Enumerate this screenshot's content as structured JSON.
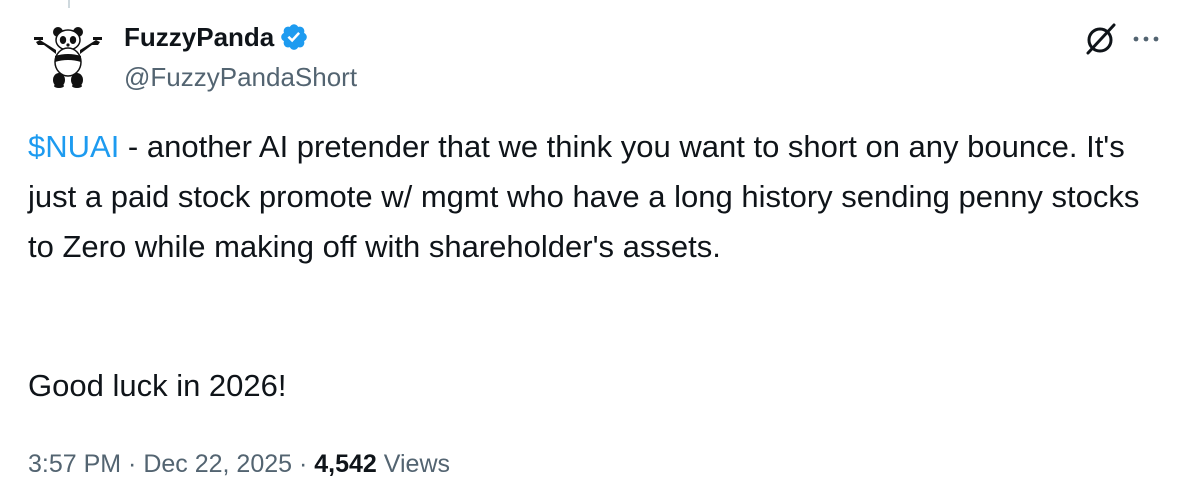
{
  "author": {
    "display_name": "FuzzyPanda",
    "handle": "@FuzzyPandaShort",
    "verified_color": "#1d9bf0"
  },
  "tweet": {
    "cashtag": "$NUAI",
    "body_rest": " - another AI pretender that we think you want to short on any bounce. It's just a paid stock promote w/ mgmt who have a long history sending penny stocks to Zero while making off with shareholder's assets.",
    "closing": "Good luck in 2026!"
  },
  "meta": {
    "time": "3:57 PM",
    "separator": " · ",
    "date": "Dec 22, 2025",
    "views_count": "4,542",
    "views_label": " Views"
  },
  "icons": {
    "avatar": "panda-avatar",
    "verified": "verified-badge-icon",
    "grok": "grok-icon",
    "more": "more-icon"
  },
  "colors": {
    "link": "#1d9bf0",
    "secondary_text": "#536471",
    "primary_text": "#0f1419"
  }
}
